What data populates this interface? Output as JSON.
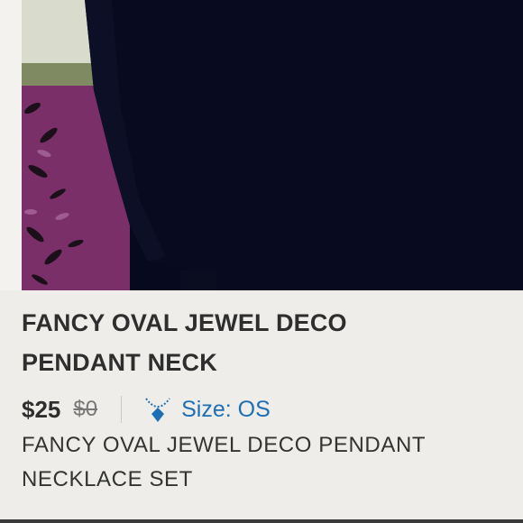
{
  "listing": {
    "photo_name": "listing-photo",
    "title_line1": "FANCY OVAL JEWEL DECO",
    "title_line2": "PENDANT NECK",
    "price": "$25",
    "original_price": "$0",
    "size_label": "Size: OS",
    "size_icon": "necklace-icon",
    "description_line1": "FANCY OVAL JEWEL DECO PENDANT",
    "description_line2": "NECKLACE SET"
  },
  "colors": {
    "background": "#eeede9",
    "text": "#2e2e2e",
    "accent": "#1d6fb5",
    "strike": "#777777"
  }
}
